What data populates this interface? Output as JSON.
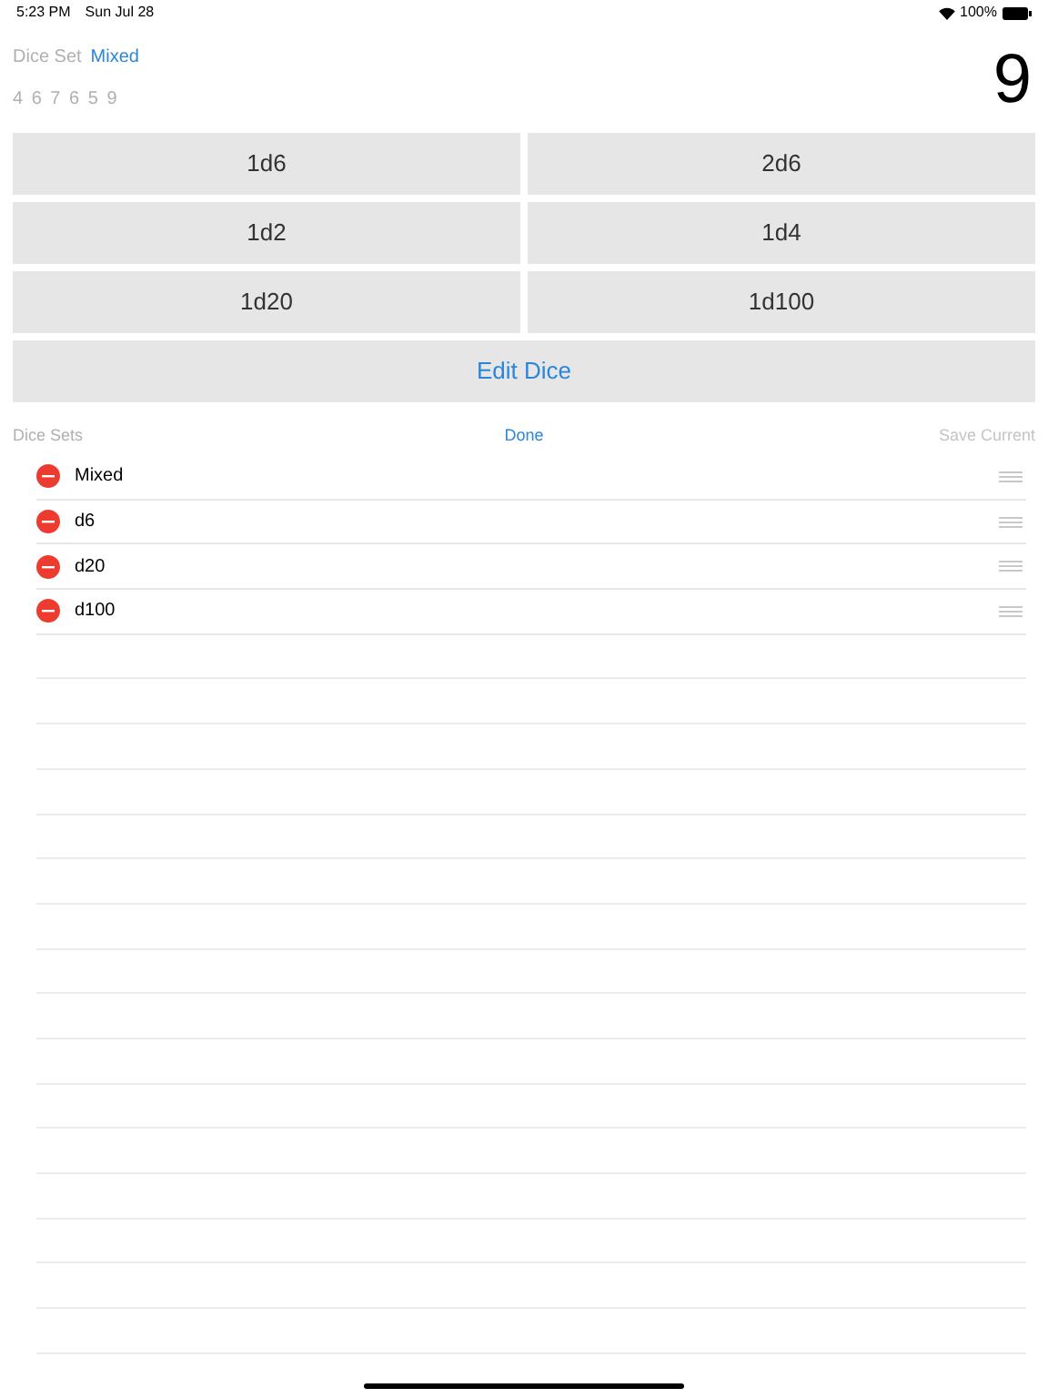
{
  "status_bar": {
    "time": "5:23 PM",
    "date": "Sun Jul 28",
    "battery": "100%"
  },
  "header": {
    "label": "Dice Set",
    "set_name": "Mixed",
    "rolls": "4 6 7 6 5 9",
    "total": "9"
  },
  "dice_buttons": [
    "1d6",
    "2d6",
    "1d2",
    "1d4",
    "1d20",
    "1d100"
  ],
  "edit_button": "Edit Dice",
  "sets_header": {
    "title": "Dice Sets",
    "done": "Done",
    "save": {
      "label": "Save Current",
      "disabled": true
    }
  },
  "sets": [
    {
      "name": "Mixed"
    },
    {
      "name": "d6"
    },
    {
      "name": "d20"
    },
    {
      "name": "d100"
    }
  ]
}
